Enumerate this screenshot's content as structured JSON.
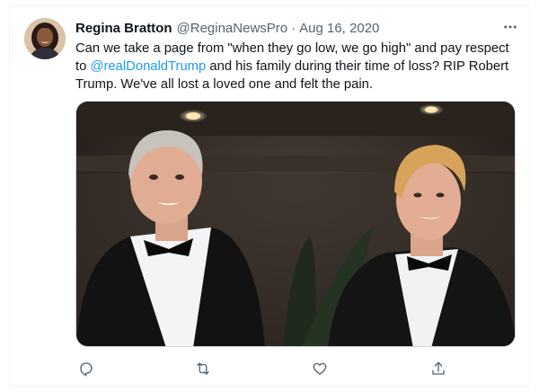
{
  "tweet": {
    "display_name": "Regina Bratton",
    "handle": "@ReginaNewsPro",
    "separator": "·",
    "date": "Aug 16, 2020",
    "text_before": "Can we take a page from \"when they go low, we go high\" and pay respect to ",
    "mention": "@realDonaldTrump",
    "text_after": " and his family during their time of loss? RIP Robert Trump. We've all lost a loved one and felt the pain."
  },
  "icons": {
    "more": "more-icon",
    "reply": "reply-icon",
    "retweet": "retweet-icon",
    "like": "like-icon",
    "share": "share-icon"
  },
  "colors": {
    "accent": "#1d9bf0",
    "secondary_text": "#536471",
    "icon": "#536471"
  }
}
